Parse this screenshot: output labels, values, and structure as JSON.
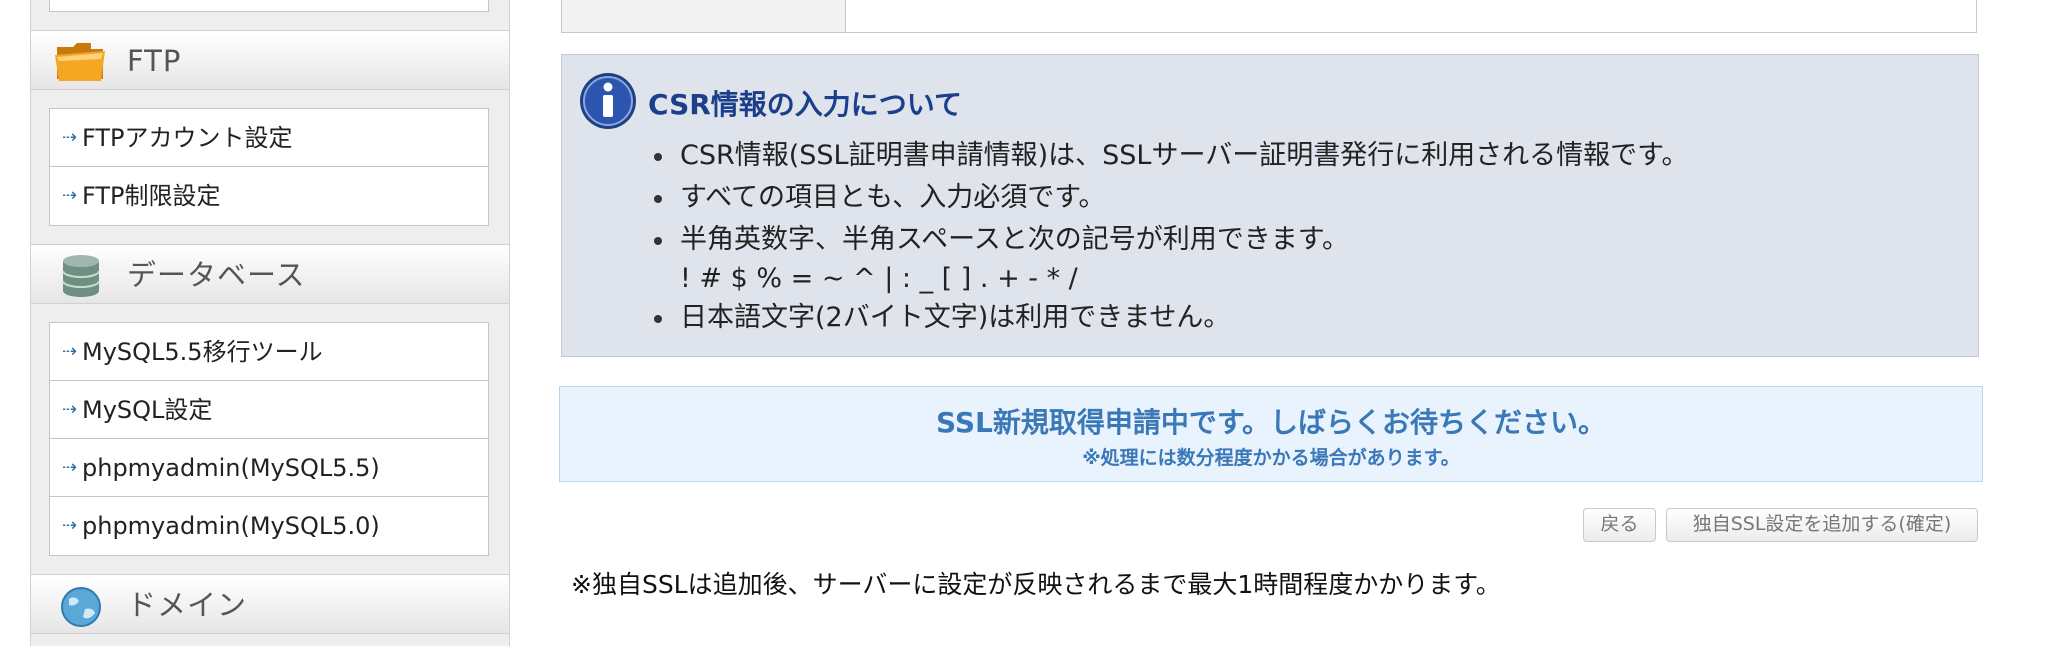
{
  "sidebar": {
    "categories": [
      {
        "label": "FTP",
        "icon": "folder-icon",
        "items": [
          {
            "label": "FTPアカウント設定"
          },
          {
            "label": "FTP制限設定"
          }
        ]
      },
      {
        "label": "データベース",
        "icon": "database-icon",
        "items": [
          {
            "label": "MySQL5.5移行ツール"
          },
          {
            "label": "MySQL設定"
          },
          {
            "label": "phpmyadmin(MySQL5.5)"
          },
          {
            "label": "phpmyadmin(MySQL5.0)"
          }
        ]
      },
      {
        "label": "ドメイン",
        "icon": "globe-icon",
        "items": []
      }
    ]
  },
  "info": {
    "icon": "info-icon",
    "title": "CSR情報の入力について",
    "items": [
      "CSR情報(SSL証明書申請情報)は、SSLサーバー証明書発行に利用される情報です。",
      "すべての項目とも、入力必須です。",
      "半角英数字、半角スペースと次の記号が利用できます。",
      "日本語文字(2バイト文字)は利用できません。"
    ],
    "symbols": "! # $ % = ~ ^ | : _ [ ] . + - * /"
  },
  "status": {
    "main": "SSL新規取得申請中です。しばらくお待ちください。",
    "sub": "※処理には数分程度かかる場合があります。"
  },
  "buttons": {
    "back": "戻る",
    "confirm": "独自SSL設定を追加する(確定)"
  },
  "footer_note": "※独自SSLは追加後、サーバーに設定が反映されるまで最大1時間程度かかります。",
  "colors": {
    "info_title": "#1b3f8b",
    "status_text": "#3a78b8",
    "info_bg": "#dfe4ec",
    "status_bg": "#e9f3fd"
  }
}
